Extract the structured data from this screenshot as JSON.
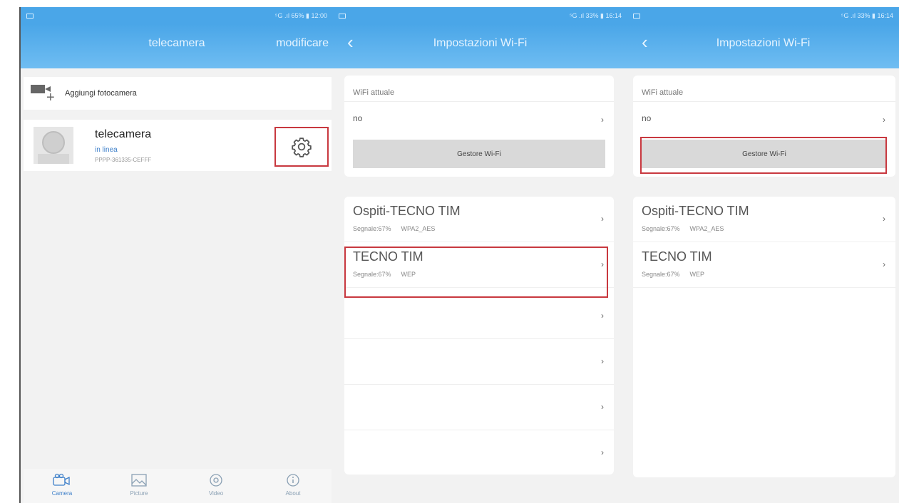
{
  "colors": {
    "accent": "#4aa6e8",
    "highlight": "#c8383f",
    "online": "#3d7fc9"
  },
  "screens": [
    {
      "status": {
        "right": "⁵G .ıl 65% ▮ 12:00"
      },
      "header": {
        "title": "telecamera",
        "action": "modificare"
      },
      "add_camera": {
        "label": "Aggiungi fotocamera",
        "icon": "add-camera-icon"
      },
      "camera": {
        "name": "telecamera",
        "status": "in linea",
        "uid": "PPPP-361335-CEFFF",
        "settings_icon": "gear-icon"
      },
      "tabs": [
        {
          "label": "Camera",
          "icon": "camera-icon"
        },
        {
          "label": "Picture",
          "icon": "picture-icon"
        },
        {
          "label": "Video",
          "icon": "video-icon"
        },
        {
          "label": "About",
          "icon": "info-icon"
        }
      ]
    },
    {
      "status": {
        "right": "⁵G .ıl 33% ▮ 16:14"
      },
      "header": {
        "title": "Impostazioni Wi-Fi"
      },
      "current": {
        "label": "WiFi attuale",
        "value": "no",
        "button": "Gestore Wi-Fi"
      },
      "networks": [
        {
          "name": "Ospiti-TECNO TIM",
          "signal": "Segnale:67%",
          "security": "WPA2_AES"
        },
        {
          "name": "TECNO TIM",
          "signal": "Segnale:67%",
          "security": "WEP"
        }
      ],
      "empty_rows": 4
    },
    {
      "status": {
        "right": "⁵G .ıl 33% ▮ 16:14"
      },
      "header": {
        "title": "Impostazioni Wi-Fi"
      },
      "current": {
        "label": "WiFi attuale",
        "value": "no",
        "button": "Gestore Wi-Fi"
      },
      "networks": [
        {
          "name": "Ospiti-TECNO TIM",
          "signal": "Segnale:67%",
          "security": "WPA2_AES"
        },
        {
          "name": "TECNO TIM",
          "signal": "Segnale:67%",
          "security": "WEP"
        }
      ]
    }
  ]
}
